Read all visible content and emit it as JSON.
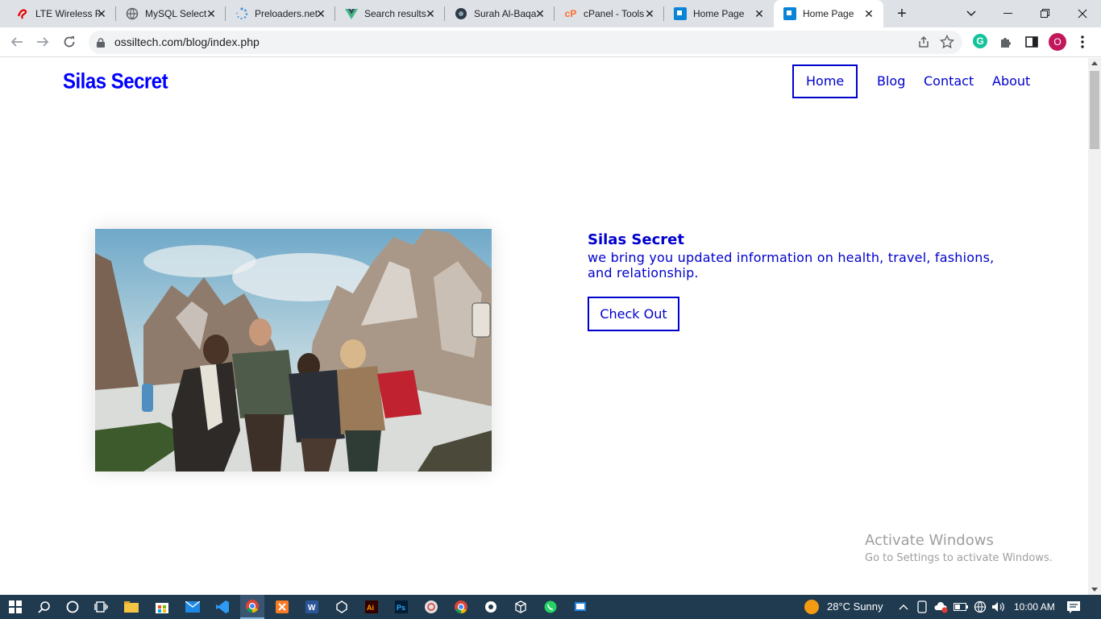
{
  "browser": {
    "tabs": [
      {
        "title": "LTE Wireless F",
        "icon": "airtel-icon",
        "active": false
      },
      {
        "title": "MySQL Select",
        "icon": "globe-icon",
        "active": false
      },
      {
        "title": "Preloaders.net",
        "icon": "spinner-icon",
        "active": false
      },
      {
        "title": "Search results",
        "icon": "vue-icon",
        "active": false
      },
      {
        "title": "Surah Al-Baqa",
        "icon": "quran-icon",
        "active": false
      },
      {
        "title": "cPanel - Tools",
        "icon": "cpanel-icon",
        "active": false
      },
      {
        "title": "Home Page",
        "icon": "site-icon",
        "active": false
      },
      {
        "title": "Home Page",
        "icon": "site-icon",
        "active": true
      }
    ],
    "new_tab_symbol": "+",
    "url": "ossiltech.com/blog/index.php",
    "profile_initial": "O",
    "grammarly_letter": "G"
  },
  "site": {
    "logo": "Silas Secret",
    "nav": [
      "Home",
      "Blog",
      "Contact",
      "About"
    ],
    "active_nav": "Home",
    "hero": {
      "title": "Silas Secret",
      "text": "we bring you updated information on health, travel, fashions, and relationship.",
      "button": "Check Out"
    },
    "colors": {
      "accent": "#0000cd",
      "logo": "#0000ff"
    }
  },
  "watermark": {
    "line1": "Activate Windows",
    "line2": "Go to Settings to activate Windows."
  },
  "taskbar": {
    "weather": "28°C  Sunny",
    "time": "10:00 AM",
    "apps": [
      "start-icon",
      "search-icon",
      "cortana-icon",
      "task-view-icon",
      "file-explorer-icon",
      "store-icon",
      "mail-icon",
      "vscode-icon",
      "chrome-icon",
      "xampp-icon",
      "word-icon",
      "unknown-app-icon",
      "illustrator-icon",
      "photoshop-icon",
      "grammarly-app-icon",
      "chrome-alt-icon",
      "app-icon",
      "package-icon",
      "whatsapp-icon",
      "app2-icon"
    ]
  }
}
